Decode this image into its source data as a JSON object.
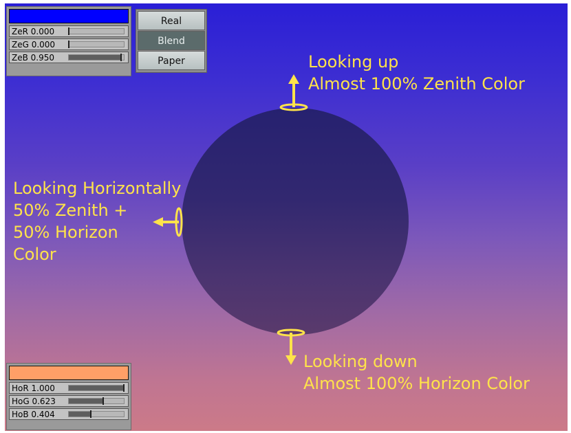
{
  "zenith_panel": {
    "color": "#0000ff",
    "sliders": [
      {
        "label": "ZeR 0.000",
        "value": 0.0
      },
      {
        "label": "ZeG 0.000",
        "value": 0.0
      },
      {
        "label": "ZeB 0.950",
        "value": 0.95
      }
    ]
  },
  "horizon_panel": {
    "color": "#ff9f67",
    "sliders": [
      {
        "label": "HoR 1.000",
        "value": 1.0
      },
      {
        "label": "HoG 0.623",
        "value": 0.623
      },
      {
        "label": "HoB 0.404",
        "value": 0.404
      }
    ]
  },
  "mode_buttons": [
    {
      "label": "Real",
      "active": false
    },
    {
      "label": "Blend",
      "active": true
    },
    {
      "label": "Paper",
      "active": false
    }
  ],
  "annotations": {
    "up": [
      "Looking up",
      "Almost 100% Zenith Color"
    ],
    "horizontal": [
      "Looking Horizontally",
      "50% Zenith +",
      "50% Horizon",
      "Color"
    ],
    "down": [
      "Looking down",
      "Almost 100% Horizon Color"
    ]
  },
  "colors": {
    "annotation": "#ffe34a",
    "sphere": "#2e2670"
  }
}
